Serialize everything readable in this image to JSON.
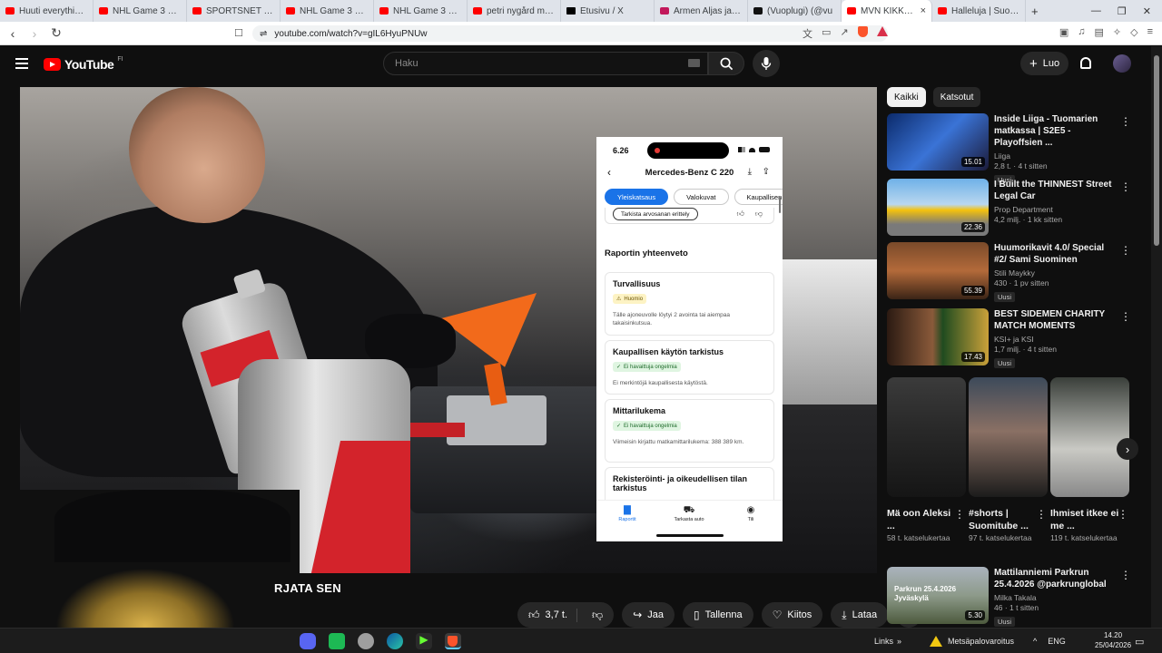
{
  "browser": {
    "tabs": [
      {
        "label": "Huuti everything...",
        "icon": "youtube-icon"
      },
      {
        "label": "NHL Game 3 Highli",
        "icon": "youtube-icon"
      },
      {
        "label": "SPORTSNET - YouTu",
        "icon": "youtube-icon"
      },
      {
        "label": "NHL Game 3 Highli",
        "icon": "youtube-icon"
      },
      {
        "label": "NHL Game 3 Highli",
        "icon": "youtube-icon"
      },
      {
        "label": "petri nygård mun le",
        "icon": "youtube-icon"
      },
      {
        "label": "Etusivu / X",
        "icon": "x-icon"
      },
      {
        "label": "Armen Aljas ja Sen",
        "icon": "iltalehti-icon"
      },
      {
        "label": "(Vuoplugi) (@vu",
        "icon": "tiktok-icon"
      },
      {
        "label": "MVN KIKKIAN",
        "icon": "youtube-icon",
        "active": true
      },
      {
        "label": "Halleluja | Suomitube",
        "icon": "youtube-icon"
      }
    ],
    "url": "youtube.com/watch?v=gIL6HyuPNUw"
  },
  "yt": {
    "logo_text": "YouTube",
    "country": "FI",
    "search_placeholder": "Haku",
    "create_label": "Luo"
  },
  "video": {
    "caption": "RJATA SEN",
    "actions": {
      "likes": "3,7 t.",
      "share": "Jaa",
      "save": "Tallenna",
      "thanks": "Kiitos",
      "download": "Lataa"
    }
  },
  "phone": {
    "time": "6.26",
    "title": "Mercedes-Benz C 220",
    "tabs": [
      "Yleiskatsaus",
      "Valokuvat",
      "Kaupallisen"
    ],
    "prev_button": "Tarkista arvosanan erittely",
    "section": "Raportin yhteenveto",
    "cards": [
      {
        "title": "Turvallisuus",
        "badge": "Huomio",
        "status": "warn",
        "desc": "Tälle ajoneuvolle löytyi 2 avointa tai aiempaa takaisinkutsua."
      },
      {
        "title": "Kaupallisen käytön tarkistus",
        "badge": "Ei havaittuja ongelmia",
        "status": "ok",
        "desc": "Ei merkintöjä kaupallisesta käytöstä."
      },
      {
        "title": "Mittarilukema",
        "badge": "Ei havaittuja ongelmia",
        "status": "ok",
        "desc": "Viimeisin kirjattu matkamittarilukema: 388 389 km."
      },
      {
        "title": "Rekisteröinti- ja oikeudellisen tilan tarkistus"
      }
    ],
    "bottom_tabs": [
      "Raportit",
      "Tarkasta auto",
      "Tili"
    ]
  },
  "sidebar": {
    "chips": [
      "Kaikki",
      "Katsotut"
    ],
    "videos": [
      {
        "title": "Inside Liiga - Tuomarien matkassa | S2E5 - Playoffsien ...",
        "channel": "Liiga",
        "views": "2,8 t. · 4 t sitten",
        "badge": "Uusi",
        "duration": "15.01"
      },
      {
        "title": "I Built the THINNEST Street Legal Car",
        "channel": "Prop Department",
        "views": "4,2 milj. · 1 kk sitten",
        "badge": "",
        "duration": "22.36"
      },
      {
        "title": "Huumorikavit 4.0/ Special #2/ Sami Suominen",
        "channel": "Stili Maykky",
        "views": "430 · 1 pv sitten",
        "badge": "Uusi",
        "duration": "55.39"
      },
      {
        "title": "BEST SIDEMEN CHARITY MATCH MOMENTS",
        "channel": "KSI+ ja KSI",
        "views": "1,7 milj. · 4 t sitten",
        "badge": "Uusi",
        "duration": "17.43"
      }
    ],
    "shorts": [
      {
        "title": "Mä oon Aleksi ...",
        "views": "58 t. katselukertaa"
      },
      {
        "title": "#shorts | Suomitube ...",
        "views": "97 t. katselukertaa"
      },
      {
        "title": "Ihmiset itkee ei me ...",
        "views": "119 t. katselukertaa"
      }
    ],
    "last_video": {
      "title": "Mattilanniemi Parkrun 25.4.2026 @parkrunglobal",
      "channel": "Milka Takala",
      "views": "46 · 1 t sitten",
      "badge": "Uusi",
      "duration": "5.30",
      "thumb_text": "Parkrun 25.4.2026 Jyväskylä"
    }
  },
  "taskbar": {
    "links": "Links",
    "weather": "Metsäpalovaroitus",
    "lang": "ENG",
    "time": "14.20",
    "date": "25/04/2026"
  },
  "colors": {
    "yt_red": "#ff0000",
    "accent_blue": "#1a73e8",
    "funnel_orange": "#f26a1b"
  }
}
